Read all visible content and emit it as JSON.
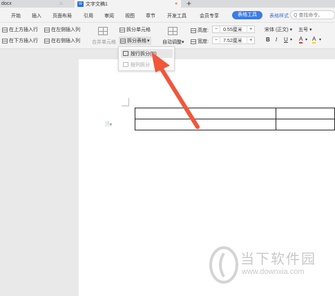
{
  "titlebar": {
    "inactive_tab": "docx",
    "active_tab": "文字文稿1",
    "doc_icon": "W",
    "new_tab": "+"
  },
  "menu": {
    "items": [
      "开始",
      "插入",
      "页面布局",
      "引用",
      "审阅",
      "视图",
      "章节",
      "开发工具",
      "会员专享"
    ],
    "active_tab": "表格工具",
    "next_tab": "表格样式",
    "search_placeholder": "Q 查找命令、"
  },
  "ribbon": {
    "insert_above": "在上方插入行",
    "insert_left": "在左侧插入列",
    "insert_below": "在下方插入行",
    "insert_right": "在右侧插入列",
    "merge_cells": "合并单元格",
    "split_cells": "拆分单元格",
    "split_table": "拆分表格",
    "auto_fit": "自动调整",
    "height_label": "高度:",
    "height_value": "0.55厘米",
    "width_label": "宽度:",
    "width_value": "7.52厘米",
    "minus": "−",
    "plus": "+",
    "font_name": "宋体 (正文)",
    "font_size": "五号",
    "bold": "B",
    "italic": "I",
    "underline": "U",
    "font_color": "A",
    "highlight": "A"
  },
  "dropdown": {
    "split_by_row": "按行拆分(R)",
    "split_by_col": "按列拆分"
  },
  "watermark": {
    "title": "当下软件园",
    "url": "www.downxia.com"
  },
  "colors": {
    "accent": "#3d7be6",
    "arrow": "#f0573a",
    "tab_dot": "#f08a3c"
  }
}
